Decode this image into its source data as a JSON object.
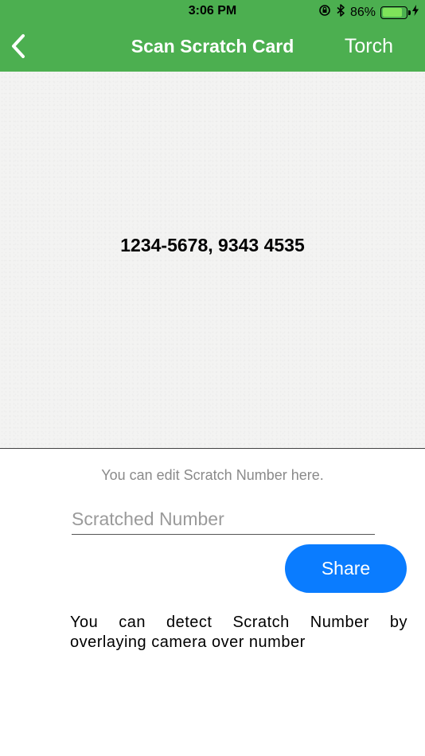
{
  "status_bar": {
    "time": "3:06 PM",
    "battery_percent": "86%",
    "battery_level": 0.86,
    "icons": [
      "orientation-lock-icon",
      "bluetooth-icon",
      "battery-icon",
      "charging-icon"
    ]
  },
  "nav": {
    "title": "Scan Scratch Card",
    "torch_label": "Torch",
    "back_icon": "chevron-left-icon"
  },
  "camera": {
    "scanned_number": "1234-5678, 9343 4535"
  },
  "edit": {
    "hint": "You can edit Scratch Number here.",
    "input_value": "",
    "input_placeholder": "Scratched Number"
  },
  "share": {
    "label": "Share"
  },
  "footer": {
    "detect_hint": "You can detect Scratch Number by overlaying camera over number"
  },
  "colors": {
    "header_green": "#4caf50",
    "share_blue": "#0a7cff",
    "battery_green": "#7fe35a"
  }
}
